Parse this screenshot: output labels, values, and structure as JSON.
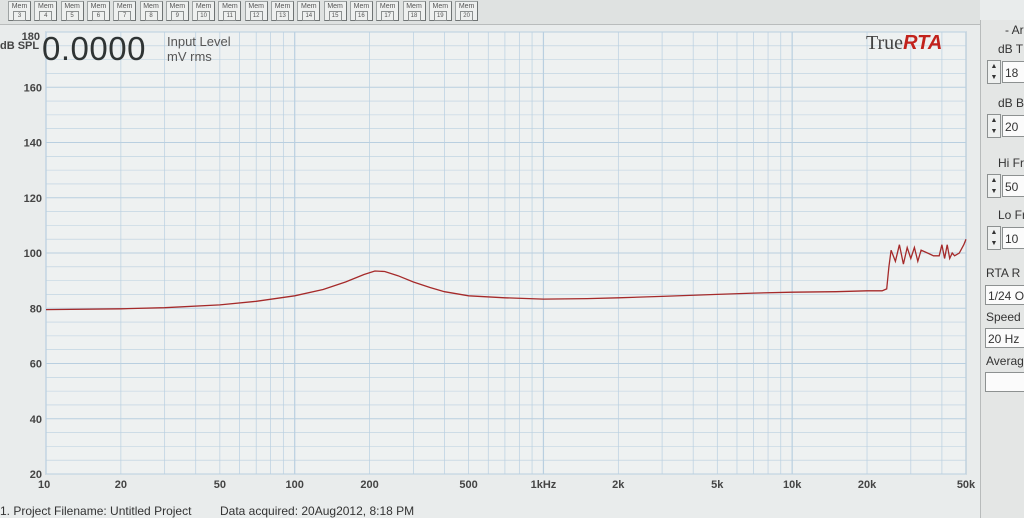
{
  "memory_buttons": [
    {
      "label": "Mem",
      "num": "3"
    },
    {
      "label": "Mem",
      "num": "4"
    },
    {
      "label": "Mem",
      "num": "5"
    },
    {
      "label": "Mem",
      "num": "6"
    },
    {
      "label": "Mem",
      "num": "7"
    },
    {
      "label": "Mem",
      "num": "8"
    },
    {
      "label": "Mem",
      "num": "9"
    },
    {
      "label": "Mem",
      "num": "10"
    },
    {
      "label": "Mem",
      "num": "11"
    },
    {
      "label": "Mem",
      "num": "12"
    },
    {
      "label": "Mem",
      "num": "13"
    },
    {
      "label": "Mem",
      "num": "14"
    },
    {
      "label": "Mem",
      "num": "15"
    },
    {
      "label": "Mem",
      "num": "16"
    },
    {
      "label": "Mem",
      "num": "17"
    },
    {
      "label": "Mem",
      "num": "18"
    },
    {
      "label": "Mem",
      "num": "19"
    },
    {
      "label": "Mem",
      "num": "20"
    }
  ],
  "readout": {
    "value": "0.0000",
    "label_line1": "Input Level",
    "label_line2": "mV rms"
  },
  "logo": {
    "part1": "True",
    "part2": "RTA"
  },
  "y_axis": {
    "unit": "dB SPL",
    "ticks": [
      "180",
      "160",
      "140",
      "120",
      "100",
      "80",
      "60",
      "40",
      "20"
    ]
  },
  "x_axis": {
    "ticks": [
      "10",
      "20",
      "50",
      "100",
      "200",
      "500",
      "1kHz",
      "2k",
      "5k",
      "10k",
      "20k",
      "50k"
    ]
  },
  "status": {
    "project": "1. Project Filename: Untitled Project",
    "acquired": "Data acquired: 20Aug2012, 8:18 PM"
  },
  "controls": {
    "db_top": {
      "label": "dB T",
      "value": "18"
    },
    "db_bottom": {
      "label": "dB B",
      "value": "20"
    },
    "hi_freq": {
      "label": "Hi Fr",
      "value": "50"
    },
    "lo_freq": {
      "label": "Lo Fr",
      "value": "10"
    },
    "rta_res": {
      "label": "RTA R",
      "value": "1/24 O"
    },
    "speed": {
      "label": "Speed",
      "value": "20 Hz"
    },
    "averaging": {
      "label": "Averag",
      "value": ""
    },
    "top_label": "- Ar"
  },
  "colors": {
    "trace": "#a52a2a",
    "grid": "#b9cfe0",
    "plot_bg": "#eef1f1",
    "brand_red": "#c2221c"
  },
  "chart_data": {
    "type": "line",
    "xscale": "log",
    "xlim": [
      10,
      50000
    ],
    "ylim": [
      20,
      180
    ],
    "ylabel": "dB SPL",
    "series": [
      {
        "x": [
          10,
          20,
          30,
          50,
          70,
          100,
          130,
          160,
          190,
          210,
          230,
          260,
          300,
          350,
          400,
          500,
          700,
          1000,
          1500,
          2000,
          3000,
          5000,
          7000,
          10000,
          15000,
          20000,
          23000,
          24000,
          24500,
          25000,
          26000,
          27000,
          28000,
          29000,
          30000,
          31000,
          32000,
          33000,
          35000,
          37000,
          39000,
          40000,
          41000,
          42000,
          43000,
          44000,
          45000,
          47000,
          49000,
          50000
        ],
        "y": [
          79.5,
          79.8,
          80.2,
          81.2,
          82.5,
          84.5,
          86.8,
          89.5,
          92.2,
          93.5,
          93.3,
          91.8,
          89.5,
          87.5,
          86,
          84.5,
          83.8,
          83.3,
          83.5,
          83.8,
          84.3,
          85,
          85.5,
          85.8,
          86,
          86.3,
          86.3,
          87,
          95,
          101,
          97,
          103,
          96,
          102,
          98,
          102,
          97,
          101,
          100,
          99,
          99,
          103,
          98,
          103,
          98,
          100,
          99,
          100,
          103,
          105
        ]
      }
    ]
  }
}
